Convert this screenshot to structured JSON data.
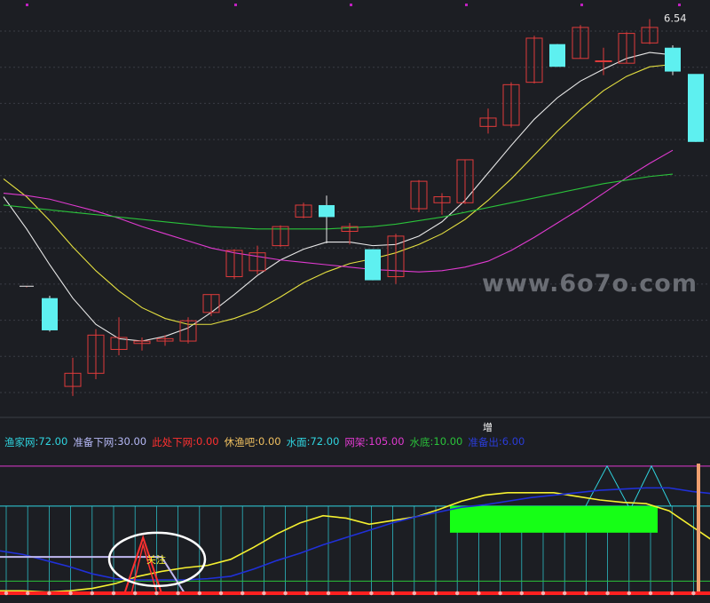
{
  "chart_data": [
    {
      "type": "candlestick",
      "panel": "price",
      "title": "",
      "xlabel": "",
      "ylabel": "",
      "ylim": [
        3.2,
        6.7
      ],
      "grid": true,
      "candles": [
        {
          "o": 4.3,
          "h": 4.3,
          "l": 4.29,
          "c": 4.3
        },
        {
          "o": 4.2,
          "h": 4.22,
          "l": 3.92,
          "c": 3.93
        },
        {
          "o": 3.46,
          "h": 3.7,
          "l": 3.38,
          "c": 3.57
        },
        {
          "o": 3.57,
          "h": 3.94,
          "l": 3.52,
          "c": 3.89
        },
        {
          "o": 3.77,
          "h": 4.04,
          "l": 3.72,
          "c": 3.87
        },
        {
          "o": 3.82,
          "h": 3.87,
          "l": 3.76,
          "c": 3.84
        },
        {
          "o": 3.84,
          "h": 3.89,
          "l": 3.8,
          "c": 3.86
        },
        {
          "o": 3.84,
          "h": 4.04,
          "l": 3.82,
          "c": 4.01
        },
        {
          "o": 4.08,
          "h": 4.23,
          "l": 4.05,
          "c": 4.23
        },
        {
          "o": 4.38,
          "h": 4.61,
          "l": 4.36,
          "c": 4.6
        },
        {
          "o": 4.43,
          "h": 4.64,
          "l": 4.4,
          "c": 4.58
        },
        {
          "o": 4.64,
          "h": 4.81,
          "l": 4.63,
          "c": 4.8
        },
        {
          "o": 4.88,
          "h": 5.0,
          "l": 4.87,
          "c": 4.98
        },
        {
          "o": 4.98,
          "h": 5.06,
          "l": 4.66,
          "c": 4.88
        },
        {
          "o": 4.76,
          "h": 4.83,
          "l": 4.65,
          "c": 4.8
        },
        {
          "o": 4.61,
          "h": 4.61,
          "l": 4.35,
          "c": 4.35
        },
        {
          "o": 4.38,
          "h": 4.74,
          "l": 4.32,
          "c": 4.72
        },
        {
          "o": 4.95,
          "h": 5.19,
          "l": 4.92,
          "c": 5.18
        },
        {
          "o": 5.0,
          "h": 5.08,
          "l": 4.9,
          "c": 5.05
        },
        {
          "o": 5.0,
          "h": 5.36,
          "l": 4.99,
          "c": 5.36
        },
        {
          "o": 5.64,
          "h": 5.79,
          "l": 5.58,
          "c": 5.71
        },
        {
          "o": 5.65,
          "h": 6.01,
          "l": 5.63,
          "c": 5.99
        },
        {
          "o": 6.01,
          "h": 6.4,
          "l": 6.0,
          "c": 6.38
        },
        {
          "o": 6.33,
          "h": 6.33,
          "l": 6.14,
          "c": 6.14
        },
        {
          "o": 6.21,
          "h": 6.49,
          "l": 6.21,
          "c": 6.47
        },
        {
          "o": 6.19,
          "h": 6.3,
          "l": 6.07,
          "c": 6.19
        },
        {
          "o": 6.17,
          "h": 6.43,
          "l": 6.17,
          "c": 6.42
        },
        {
          "o": 6.34,
          "h": 6.54,
          "l": 6.33,
          "c": 6.47
        },
        {
          "o": 6.3,
          "h": 6.32,
          "l": 6.07,
          "c": 6.1
        },
        {
          "o": 6.08,
          "h": 6.07,
          "l": 5.51,
          "c": 5.51
        }
      ],
      "ma": [
        {
          "color": "#e8e8e8",
          "values": [
            5.05,
            4.78,
            4.48,
            4.2,
            3.98,
            3.86,
            3.84,
            3.88,
            3.95,
            4.08,
            4.23,
            4.39,
            4.52,
            4.61,
            4.67,
            4.67,
            4.64,
            4.65,
            4.72,
            4.84,
            5.02,
            5.25,
            5.48,
            5.7,
            5.88,
            6.02,
            6.12,
            6.21,
            6.26,
            6.24
          ]
        },
        {
          "color": "#e5e040",
          "values": [
            5.2,
            5.05,
            4.85,
            4.63,
            4.43,
            4.26,
            4.12,
            4.03,
            3.98,
            3.98,
            4.03,
            4.1,
            4.21,
            4.33,
            4.42,
            4.49,
            4.53,
            4.58,
            4.65,
            4.74,
            4.86,
            5.02,
            5.2,
            5.4,
            5.6,
            5.78,
            5.94,
            6.06,
            6.14,
            6.16
          ]
        },
        {
          "color": "#e03ad0",
          "values": [
            5.08,
            5.06,
            5.03,
            4.98,
            4.93,
            4.87,
            4.8,
            4.74,
            4.68,
            4.62,
            4.58,
            4.55,
            4.52,
            4.5,
            4.48,
            4.46,
            4.44,
            4.43,
            4.42,
            4.43,
            4.46,
            4.51,
            4.6,
            4.71,
            4.83,
            4.95,
            5.08,
            5.21,
            5.33,
            5.44
          ]
        },
        {
          "color": "#2ac23a",
          "values": [
            4.98,
            4.96,
            4.94,
            4.92,
            4.9,
            4.88,
            4.86,
            4.84,
            4.82,
            4.8,
            4.79,
            4.78,
            4.78,
            4.78,
            4.78,
            4.79,
            4.8,
            4.82,
            4.85,
            4.88,
            4.92,
            4.96,
            5.0,
            5.04,
            5.08,
            5.12,
            5.16,
            5.19,
            5.22,
            5.24
          ]
        }
      ],
      "annotations": [
        {
          "text": "6.54",
          "candle": 27,
          "value": 6.54
        }
      ]
    },
    {
      "type": "line",
      "panel": "indicator",
      "title": "",
      "xlabel": "",
      "ylabel": "",
      "ylim": [
        0,
        110
      ],
      "legend_entries": [
        {
          "name": "渔家网",
          "value": "72.00",
          "color": "#2fd5e0"
        },
        {
          "name": "准备下网",
          "value": "30.00",
          "color": "#b5b8f5"
        },
        {
          "name": "此处下网",
          "value": "0.00",
          "color": "#ff3030"
        },
        {
          "name": "休渔吧",
          "value": "0.00",
          "color": "#f0c060"
        },
        {
          "name": "水面",
          "value": "72.00",
          "color": "#2fd5e0"
        },
        {
          "name": "网架",
          "value": "105.00",
          "color": "#e03ad0"
        },
        {
          "name": "水底",
          "value": "10.00",
          "color": "#2ac23a"
        },
        {
          "name": "准备出",
          "value": "6.00",
          "color": "#2a3cd8"
        }
      ],
      "levels": {
        "surface": 72,
        "frame": 105,
        "bottom": 10
      },
      "series": [
        {
          "color": "#f5f030",
          "values": [
            2,
            2,
            1,
            2,
            4,
            8,
            14,
            18,
            21,
            23,
            28,
            38,
            49,
            58,
            64,
            62,
            57,
            60,
            63,
            69,
            76,
            81,
            83,
            83,
            83,
            80,
            77,
            75,
            74,
            68,
            55,
            42
          ]
        },
        {
          "color": "#2030d8",
          "values": [
            35,
            32,
            27,
            22,
            16,
            12,
            11,
            11,
            11,
            12,
            14,
            20,
            27,
            33,
            40,
            46,
            52,
            58,
            63,
            67,
            71,
            73,
            76,
            79,
            81,
            83,
            85,
            86,
            87,
            87,
            84,
            82
          ]
        },
        {
          "color": "#c0b8f0",
          "values": [
            30,
            30,
            30,
            30,
            30,
            30,
            30,
            30,
            0,
            0,
            0,
            0,
            0,
            0,
            0,
            0,
            0,
            0,
            0,
            0,
            0,
            0,
            0,
            0,
            0,
            0,
            0,
            0,
            0,
            0,
            0,
            0
          ]
        }
      ],
      "highlight_box": {
        "from": 19.5,
        "to": 28.5,
        "low": 50,
        "high": 72,
        "color": "#16ff16"
      },
      "callout": {
        "text": "关注",
        "index": 6.5
      },
      "top_label": "增"
    }
  ]
}
